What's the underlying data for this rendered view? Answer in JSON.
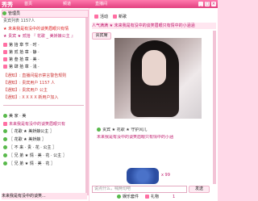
{
  "app": {
    "logo": "秀秀"
  },
  "topbar": {
    "tabs": [
      "首页",
      "频道",
      "直播间"
    ],
    "window_buttons": [
      "_",
      "□",
      "×"
    ]
  },
  "left": {
    "manager_header": "管理员",
    "online_count": "贵宾列表 1157人",
    "marquee_1": "★ 未来我是有没中的谈笑眉眼只有情  ",
    "marquee_2": "★ 贵宾 ★ 贰拾 『 花歌 _ 美娇娘公主 』",
    "rank_rows": [
      {
        "prefix": "第",
        "name": "第 拾 章 节 · 时 ·"
      },
      {
        "prefix": "第",
        "name": "第 贰 拾 章 · 静 ·"
      },
      {
        "prefix": "第",
        "name": "第 叁 拾 章 · 美 ·"
      },
      {
        "prefix": "第",
        "name": "第 肆 拾 章 · 浅 ·"
      }
    ],
    "notice_1": "【通知】: 直播间提示禁言警告规则",
    "notice_2": "【通知】: 贵宾用户 1157 人",
    "notice_3": "【通知】: 贵宾用户 公主",
    "notice_4": "【通知】: X X X X 新用户加入",
    "user_1": "美 家 · 美",
    "user_2": "未来我是有没中的谈笑眉眼只有",
    "user_3": "〖 花歌 ★ 美娇娘公主 〗",
    "user_4": "〖 花歌 ★ 美娇娘 〗",
    "user_5": "〖 不 来 · 贵 · 花 · 公主 〗",
    "user_6": "〖 兄 弟 ★ 情 · 美 · 花 · 公主 〗",
    "user_7": "〖 兄 弟 ★ 情 · 美 · 花 〗",
    "footer": "未来我是有没中的谈笑..."
  },
  "right": {
    "tabs": [
      "活动",
      "新歌"
    ],
    "room_title": "人气满满 ★ 未来我是有没中的谈笑眉眼只有情中的小涵涵",
    "host_badge": "贵宾席",
    "gift_line": "贵宾 ★ 花歌 ★ 守护风儿",
    "gift_line2": "未来我是有没中的谈笑眉眼只有情中的小涵",
    "gift_count": "x 99",
    "input_placeholder": "说点什么，喊两句吧",
    "send_label": "发送",
    "bottom_tabs": [
      "娱乐套件",
      "礼物"
    ],
    "bottom_page": "1",
    "bottom_bar": "未来我是有没中的谈笑"
  }
}
